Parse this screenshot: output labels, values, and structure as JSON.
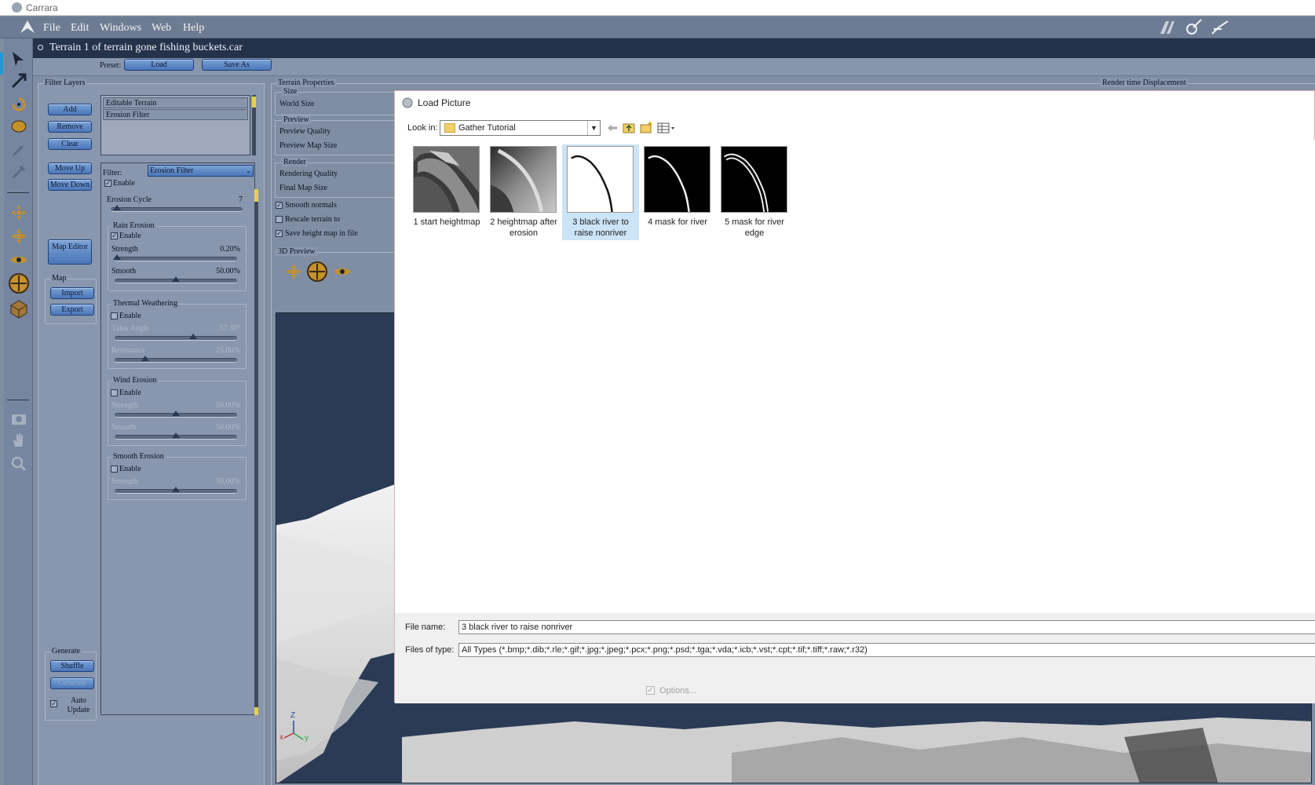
{
  "os_title": "Carrara",
  "menu": [
    "File",
    "Edit",
    "Windows",
    "Web",
    "Help"
  ],
  "document_title": "Terrain 1 of terrain gone fishing buckets.car",
  "preset": {
    "label": "Preset:",
    "load": "Load",
    "save_as": "Save As"
  },
  "filter_layers": {
    "title": "Filter Layers",
    "buttons": [
      "Add",
      "Remove",
      "Clear",
      "Move Up",
      "Move Down",
      "Map Editor"
    ],
    "layers": [
      "Editable Terrain",
      "Erosion Filter"
    ],
    "map_group": "Map",
    "import": "Import",
    "export": "Export",
    "generate_group": "Generate",
    "shuffle": "Shuffle",
    "generate": "Generate",
    "auto_update": "Auto Update"
  },
  "filter": {
    "label": "Filter:",
    "selected": "Erosion Filter",
    "enable": "Enable",
    "erosion_cycle": {
      "label": "Erosion Cycle",
      "value": "7",
      "fraction": 0.05
    },
    "rain": {
      "title": "Rain Erosion",
      "enable": "Enable",
      "enabled": true,
      "strength": {
        "label": "Strength",
        "value": "0.20%",
        "fraction": 0.02
      },
      "smooth": {
        "label": "Smooth",
        "value": "50.00%",
        "fraction": 0.5
      }
    },
    "thermal": {
      "title": "Thermal Weathering",
      "enable": "Enable",
      "enabled": false,
      "talus": {
        "label": "Talus Angle",
        "value": "57.30°",
        "fraction": 0.64
      },
      "resistance": {
        "label": "Resistance",
        "value": "25.00%",
        "fraction": 0.25
      }
    },
    "wind": {
      "title": "Wind Erosion",
      "enable": "Enable",
      "enabled": false,
      "strength": {
        "label": "Strength",
        "value": "50.00%",
        "fraction": 0.5
      },
      "smooth": {
        "label": "Smooth",
        "value": "50.00%",
        "fraction": 0.5
      }
    },
    "smooth_erosion": {
      "title": "Smooth Erosion",
      "enable": "Enable",
      "enabled": false,
      "strength": {
        "label": "Strength",
        "value": "50.00%",
        "fraction": 0.5
      }
    }
  },
  "terrain_properties": {
    "title": "Terrain Properties",
    "size_group": "Size",
    "world_size": "World Size",
    "preview_group": "Preview",
    "preview_quality": "Preview Quality",
    "preview_map_size": "Preview Map Size",
    "render_group": "Render",
    "rendering_quality": "Rendering Quality",
    "final_map_size": "Final Map Size",
    "smooth_normals": "Smooth normals",
    "rescale_terrain": "Rescale terrain to",
    "save_height_map": "Save height map in file",
    "preview_3d": "3D Preview",
    "render_time_displacement": "Render time Displacement"
  },
  "axes": {
    "z": "Z",
    "x": "x",
    "y": "y"
  },
  "dialog": {
    "title": "Load Picture",
    "look_in_label": "Look in:",
    "look_in_value": "Gather Tutorial",
    "files": [
      {
        "name": "1 start heightmap",
        "icon": "heightmap-thumbnail"
      },
      {
        "name": "2 heightmap after erosion",
        "icon": "eroded-heightmap-thumbnail"
      },
      {
        "name": "3 black river to raise nonriver",
        "icon": "black-river-thumbnail"
      },
      {
        "name": "4 mask for river",
        "icon": "river-mask-thumbnail"
      },
      {
        "name": "5 mask for river edge",
        "icon": "river-edge-mask-thumbnail"
      }
    ],
    "selected_index": 2,
    "file_name_label": "File name:",
    "file_name_value": "3 black river to raise nonriver",
    "files_of_type_label": "Files of type:",
    "files_of_type_value": "All Types (*.bmp;*.dib;*.rle;*.gif;*.jpg;*.jpeg;*.pcx;*.png;*.psd;*.tga;*.vda;*.icb;*.vst;*.cpt;*.tif;*.tiff;*.raw;*.r32)",
    "options": "Options..."
  }
}
